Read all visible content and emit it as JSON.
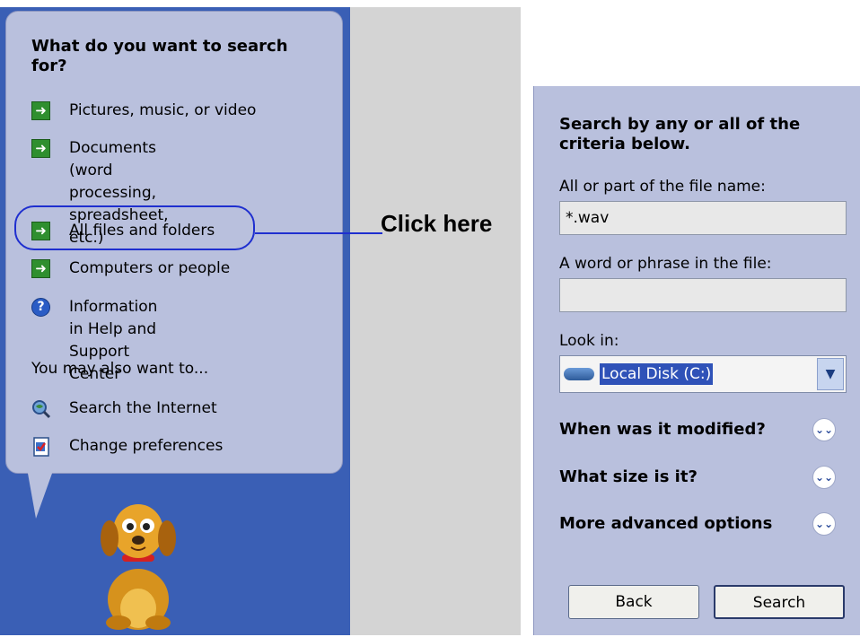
{
  "left": {
    "title": "What do you want to search for?",
    "options": [
      {
        "label": "Pictures, music, or video",
        "icon": "green-arrow-icon"
      },
      {
        "label": "Documents (word\nprocessing, spreadsheet,\netc.)",
        "icon": "green-arrow-icon"
      },
      {
        "label": "All files and folders",
        "icon": "green-arrow-icon"
      },
      {
        "label": "Computers or people",
        "icon": "green-arrow-icon"
      },
      {
        "label": "Information in Help and\nSupport Center",
        "icon": "help-icon"
      }
    ],
    "also_label": "You may also want to...",
    "also": [
      {
        "label": "Search the Internet",
        "icon": "search-internet-icon"
      },
      {
        "label": "Change preferences",
        "icon": "preferences-icon"
      }
    ]
  },
  "callout": "Click here",
  "right": {
    "title": "Search by any or all of the criteria below.",
    "filename_label": "All or part of the file name:",
    "filename_value": "*.wav",
    "phrase_label": "A word or phrase in the file:",
    "phrase_value": "",
    "lookin_label": "Look in:",
    "lookin_value": "Local Disk (C:)",
    "sections": [
      "When was it modified?",
      "What size is it?",
      "More advanced options"
    ],
    "back_button": "Back",
    "search_button": "Search"
  },
  "colors": {
    "bubble": "#b9c0dd",
    "left_background": "#3a5fb5",
    "highlight": "#1f2fcf",
    "arrow_green": "#2f8f2f"
  }
}
